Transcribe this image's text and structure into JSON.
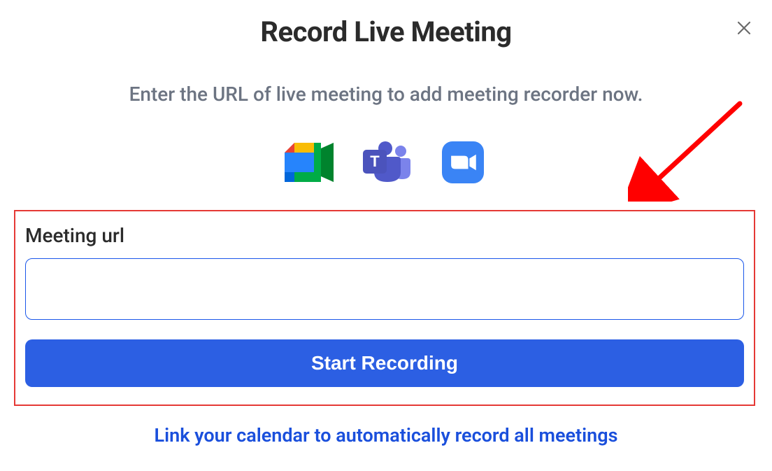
{
  "dialog": {
    "title": "Record Live Meeting",
    "subtitle": "Enter the URL of live meeting to add meeting recorder now.",
    "close_icon": "close"
  },
  "providers": [
    {
      "name": "google-meet"
    },
    {
      "name": "microsoft-teams"
    },
    {
      "name": "zoom"
    }
  ],
  "form": {
    "url_label": "Meeting url",
    "url_value": "",
    "url_placeholder": "",
    "start_button_label": "Start Recording"
  },
  "footer": {
    "link_calendar_text": "Link your calendar to automatically record all meetings"
  },
  "annotations": {
    "highlight_box": true,
    "red_arrow": true
  },
  "colors": {
    "primary": "#2c5fe3",
    "highlight": "#e53935",
    "text_muted": "#6c7482"
  }
}
